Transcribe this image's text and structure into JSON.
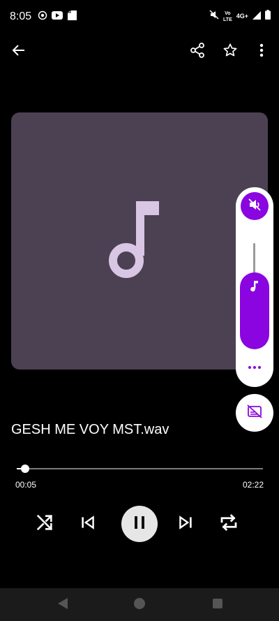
{
  "status_bar": {
    "time": "8:05",
    "network_line1": "Vo",
    "network_line2": "LTE",
    "network_type": "4G+",
    "icons": [
      "screen-record-icon",
      "youtube-icon",
      "notification-icon",
      "mute-icon",
      "signal-icon",
      "battery-icon"
    ]
  },
  "app_bar": {
    "icons": [
      "back-arrow-icon",
      "share-icon",
      "star-icon",
      "more-vert-icon"
    ]
  },
  "track": {
    "title": "GESH ME VOY MST.wav",
    "elapsed": "00:05",
    "duration": "02:22",
    "progress_fraction": 0.035
  },
  "volume": {
    "level_fraction": 0.6,
    "accent_color": "#8a05e0"
  },
  "colors": {
    "background": "#000000",
    "art_background": "#4c4152",
    "art_icon": "#d8c6e4",
    "accent": "#8a05e0",
    "nav_bar": "#1b1b1b"
  },
  "controls": {
    "icons": [
      "shuffle-icon",
      "skip-previous-icon",
      "pause-icon",
      "skip-next-icon",
      "repeat-icon"
    ]
  },
  "nav_bar": {
    "icons": [
      "nav-back-icon",
      "nav-home-icon",
      "nav-recents-icon"
    ]
  }
}
